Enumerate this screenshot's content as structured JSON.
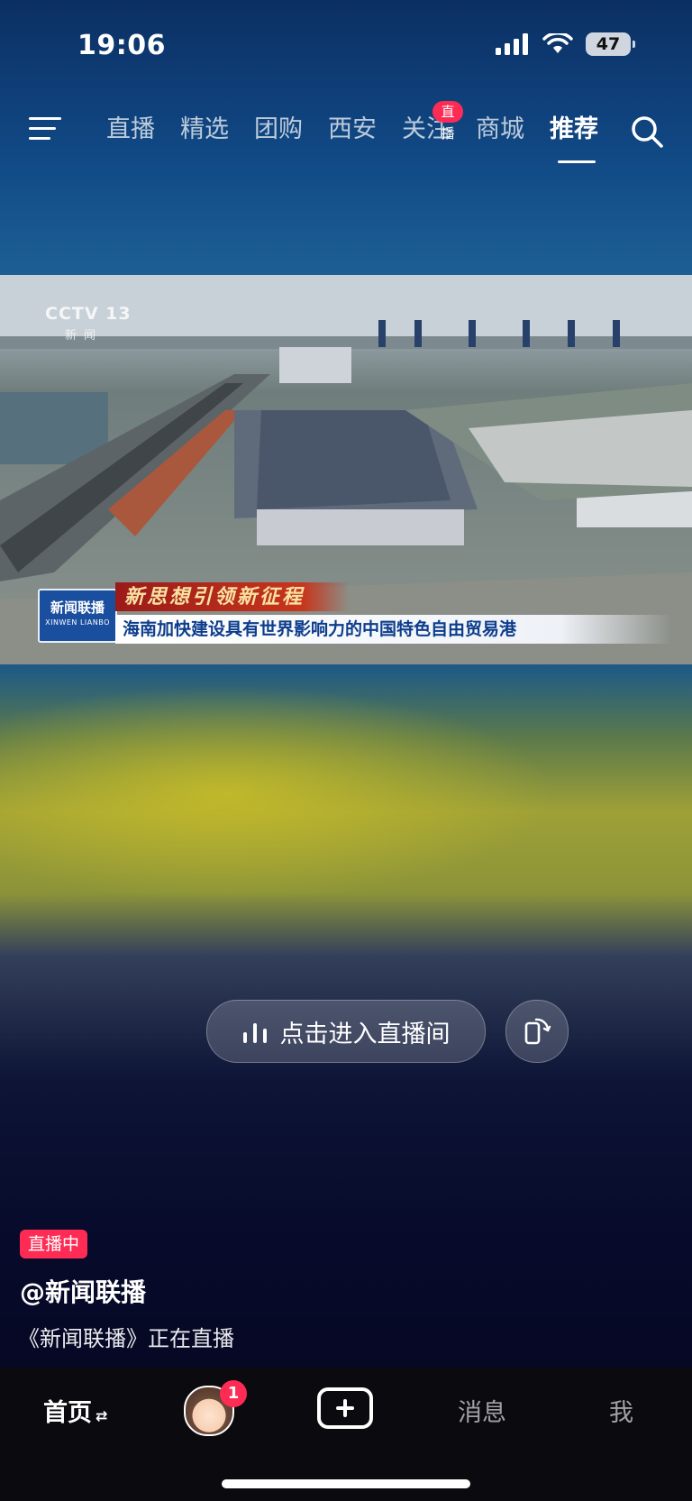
{
  "status_bar": {
    "time": "19:06",
    "battery": "47"
  },
  "top_nav": {
    "tabs": [
      {
        "label": "直播",
        "active": false
      },
      {
        "label": "精选",
        "active": false
      },
      {
        "label": "团购",
        "active": false
      },
      {
        "label": "西安",
        "active": false
      },
      {
        "label": "关注",
        "active": false,
        "badge": "直播"
      },
      {
        "label": "商城",
        "active": false
      },
      {
        "label": "推荐",
        "active": true
      }
    ]
  },
  "video": {
    "channel_logo": "CCTV 13",
    "channel_sub": "新闻",
    "program_logo_cn": "新闻联播",
    "program_logo_en": "XINWEN LIANBO",
    "banner_title": "新思想引领新征程",
    "banner_subtitle": "海南加快建设具有世界影响力的中国特色自由贸易港"
  },
  "live": {
    "enter_button_label": "点击进入直播间",
    "live_tag": "直播中",
    "author": "@新闻联播",
    "description": "《新闻联播》正在直播"
  },
  "tabbar": {
    "home": "首页",
    "home_suffix": "⇄",
    "friends_badge": "1",
    "messages": "消息",
    "me": "我"
  }
}
